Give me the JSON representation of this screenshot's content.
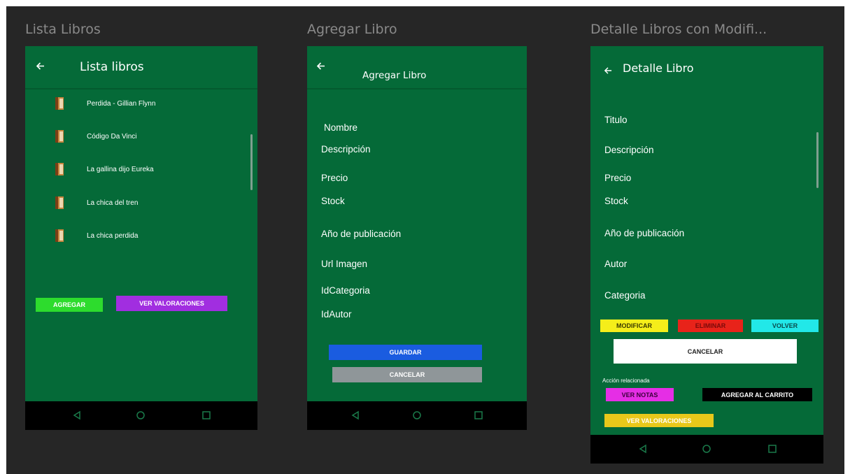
{
  "frames": [
    {
      "title": "Lista Libros"
    },
    {
      "title": "Agregar Libro"
    },
    {
      "title": "Detalle Libros con Modifi..."
    }
  ],
  "lista": {
    "appbar_title": "Lista libros",
    "items": [
      {
        "label": "Perdida - Gillian Flynn"
      },
      {
        "label": "Código Da Vinci"
      },
      {
        "label": "La gallina dijo Eureka"
      },
      {
        "label": "La chica del tren"
      },
      {
        "label": "La chica perdida"
      }
    ],
    "agregar_label": "AGREGAR",
    "ver_valoraciones_label": "VER VALORACIONES"
  },
  "agregar": {
    "appbar_title": "Agregar Libro",
    "fields": [
      "Nombre",
      "Descripción",
      "Precio",
      "Stock",
      "Año de publicación",
      "Url Imagen",
      "IdCategoria",
      "IdAutor"
    ],
    "guardar_label": "GUARDAR",
    "cancelar_label": "CANCELAR"
  },
  "detalle": {
    "appbar_title": "Detalle Libro",
    "fields": [
      "Titulo",
      "Descripción",
      "Precio",
      "Stock",
      "Año de publicación",
      "Autor",
      "Categoria"
    ],
    "modificar_label": "MODIFICAR",
    "eliminar_label": "ELIMINAR",
    "volver_label": "VOLVER",
    "cancelar_label": "CANCELAR",
    "accion_relacionada": "Acción relacionada",
    "ver_notas_label": "VER NOTAS",
    "agregar_carrito_label": "AGREGAR AL CARRITO",
    "ver_valoraciones_label": "VER VALORACIONES"
  },
  "colors": {
    "canvas": "#262626",
    "screen_green": "#056a38",
    "agregar_green": "#2ddc2d",
    "purple": "#a12ee0",
    "blue": "#1a5ce0",
    "gray": "#8f9699",
    "yellow": "#f5ee1a",
    "red": "#e8231a",
    "cyan": "#22e8e8",
    "magenta": "#e52ee5",
    "gold": "#e8c81a"
  },
  "icons": {
    "back": "arrow-left-icon",
    "book": "book-icon",
    "nav_back": "triangle-back-icon",
    "nav_home": "circle-home-icon",
    "nav_recent": "square-recent-icon"
  }
}
